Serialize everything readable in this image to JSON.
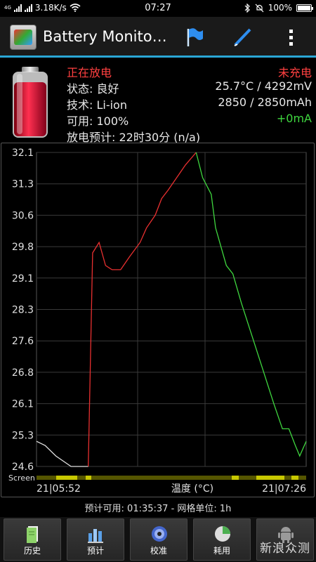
{
  "status_bar": {
    "net_type": "4G",
    "speed": "3.18K/s",
    "time": "07:27",
    "battery_percent": "100%",
    "battery_level": 1.0
  },
  "action_bar": {
    "title": "Battery Monito…",
    "icons": [
      "app-icon",
      "flag-icon",
      "pencil-icon",
      "overflow-menu-icon"
    ]
  },
  "info": {
    "state_label": "正在放电",
    "charge_label": "未充电",
    "status_line": "状态: 良好",
    "temp_voltage": "25.7°C / 4292mV",
    "tech_line": "技术: Li-ion",
    "capacity": "2850 / 2850mAh",
    "available_line": "可用: 100%",
    "current": "+0mA",
    "estimate_line": "放电预计: 22时30分 (n/a)"
  },
  "chart_data": {
    "type": "line",
    "title": "",
    "xlabel": "温度 (°C)",
    "ylabel": "",
    "y_ticks": [
      "32.1",
      "31.3",
      "30.6",
      "29.8",
      "29.1",
      "28.3",
      "27.6",
      "26.8",
      "26.1",
      "25.3",
      "24.6"
    ],
    "ylim": [
      24.6,
      32.1
    ],
    "x_start_label": "21|05:52",
    "x_end_label": "21|07:26",
    "screen_label": "Screen",
    "series": [
      {
        "color": "#e0e0e0",
        "points": [
          [
            0,
            25.2
          ],
          [
            0.04,
            25.1
          ],
          [
            0.09,
            24.85
          ],
          [
            0.16,
            24.6
          ],
          [
            0.24,
            24.6
          ]
        ]
      },
      {
        "color": "#e83030",
        "points": [
          [
            0.24,
            24.6
          ],
          [
            0.26,
            29.7
          ],
          [
            0.29,
            29.95
          ],
          [
            0.32,
            29.4
          ],
          [
            0.35,
            29.3
          ],
          [
            0.39,
            29.3
          ],
          [
            0.43,
            29.6
          ],
          [
            0.48,
            29.95
          ],
          [
            0.51,
            30.3
          ],
          [
            0.55,
            30.6
          ],
          [
            0.58,
            31.0
          ],
          [
            0.61,
            31.2
          ],
          [
            0.65,
            31.5
          ],
          [
            0.69,
            31.8
          ],
          [
            0.74,
            32.1
          ]
        ]
      },
      {
        "color": "#3fd73f",
        "points": [
          [
            0.74,
            32.1
          ],
          [
            0.77,
            31.5
          ],
          [
            0.81,
            31.1
          ],
          [
            0.83,
            30.3
          ],
          [
            0.88,
            29.4
          ],
          [
            0.91,
            29.2
          ],
          [
            0.95,
            28.5
          ],
          [
            1.0,
            27.7
          ],
          [
            1.05,
            26.9
          ],
          [
            1.1,
            26.1
          ],
          [
            1.14,
            25.5
          ],
          [
            1.17,
            25.5
          ],
          [
            1.2,
            25.1
          ],
          [
            1.22,
            24.85
          ],
          [
            1.25,
            25.2
          ]
        ]
      }
    ]
  },
  "footer": {
    "text": "预计可用:  01:35:37 - 网格单位:  1h"
  },
  "tabs": [
    {
      "label": "历史",
      "icon": "history-icon"
    },
    {
      "label": "预计",
      "icon": "estimate-icon"
    },
    {
      "label": "校准",
      "icon": "calibrate-icon"
    },
    {
      "label": "耗用",
      "icon": "usage-icon"
    },
    {
      "label": "",
      "icon": "android-icon"
    }
  ],
  "watermark": "新浪众测",
  "colors": {
    "accent": "#2aa7d6",
    "red": "#ff4040",
    "green": "#3fd73f"
  }
}
